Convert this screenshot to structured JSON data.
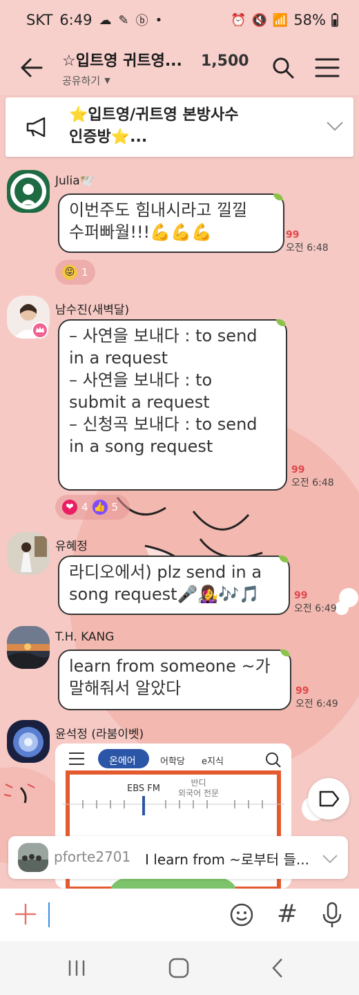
{
  "status_bar": {
    "carrier": "SKT",
    "time": "6:49",
    "battery": "58%"
  },
  "header": {
    "title": "☆입트영 귀트영...",
    "member_count": "1,500",
    "share_label": "공유하기"
  },
  "notice": {
    "line1": "⭐입트영/귀트영 본방사수",
    "line2": "인증방⭐..."
  },
  "messages": [
    {
      "sender": "Julia🕊️",
      "lines": [
        "이번주도 힘내시라고 낄낄",
        "수퍼빠월!!!💪💪💪"
      ],
      "unread": "99",
      "time": "오전 6:48",
      "reaction": {
        "emoji": "😝",
        "count": "1"
      }
    },
    {
      "sender": "남수진(새벽달)",
      "lines": [
        "– 사연을 보내다 : to send",
        "in a request",
        "– 사연을 보내다 : to",
        "submit a request",
        "– 신청곡 보내다 : to send",
        "in a song request"
      ],
      "unread": "99",
      "time": "오전 6:48",
      "reactions": [
        {
          "emoji": "❤",
          "count": "4"
        },
        {
          "emoji": "👍",
          "count": "5"
        }
      ]
    },
    {
      "sender": "유혜정",
      "lines": [
        "라디오에서) plz send in a",
        "song request🎤👩‍🎤🎶🎵"
      ],
      "unread": "99",
      "time": "오전 6:49"
    },
    {
      "sender": "T.H. KANG",
      "lines": [
        "learn from someone ~가",
        "말해줘서 알았다"
      ],
      "unread": "99",
      "time": "오전 6:49"
    },
    {
      "sender": "윤석정 (라붐이벳)",
      "image": {
        "tabs": [
          "온에어",
          "어학당",
          "e지식"
        ],
        "station": "EBS FM",
        "program": "반디\n외국어 전문"
      }
    }
  ],
  "preview": {
    "user": "pforte2701",
    "text": "I learn from ~로부터 들..."
  },
  "input": {
    "placeholder": ""
  },
  "colors": {
    "background": "#f6c9c4",
    "unread": "#e0474c",
    "accent": "#3a8ee6"
  }
}
